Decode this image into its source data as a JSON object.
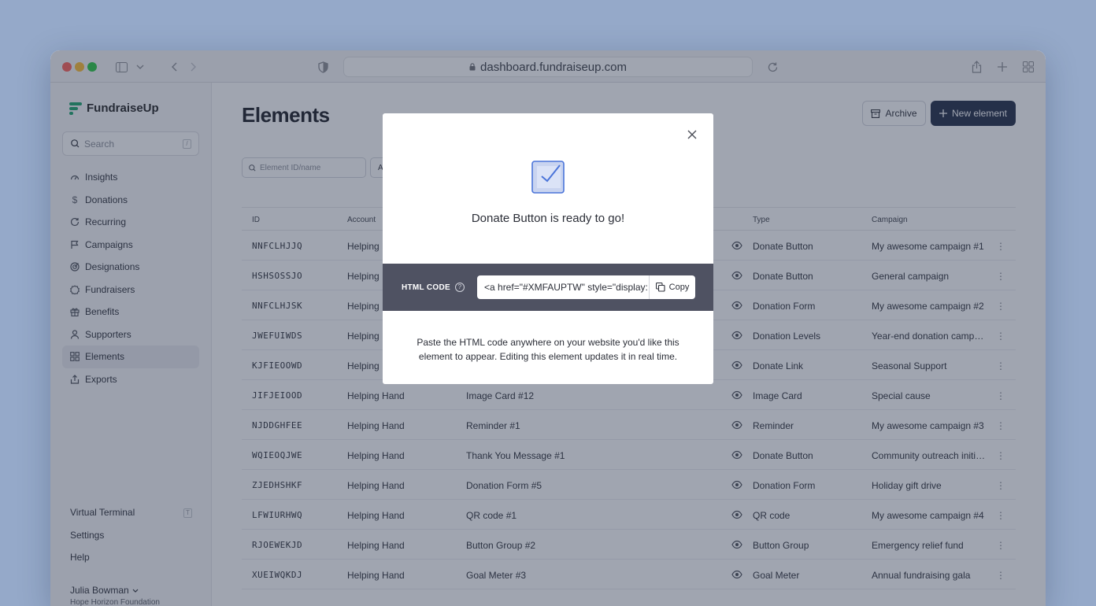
{
  "browser": {
    "url": "dashboard.fundraiseup.com"
  },
  "sidebar": {
    "logo": "FundraiseUp",
    "search_placeholder": "Search",
    "search_shortcut": "/",
    "items": [
      {
        "label": "Insights",
        "icon": "gauge-icon"
      },
      {
        "label": "Donations",
        "icon": "dollar-icon"
      },
      {
        "label": "Recurring",
        "icon": "refresh-icon"
      },
      {
        "label": "Campaigns",
        "icon": "flag-icon"
      },
      {
        "label": "Designations",
        "icon": "target-icon"
      },
      {
        "label": "Fundraisers",
        "icon": "badge-icon"
      },
      {
        "label": "Benefits",
        "icon": "gift-icon"
      },
      {
        "label": "Supporters",
        "icon": "person-icon"
      },
      {
        "label": "Elements",
        "icon": "grid-icon"
      },
      {
        "label": "Exports",
        "icon": "export-icon"
      }
    ],
    "active_item": "Elements",
    "bottom": {
      "virtual_terminal": "Virtual Terminal",
      "virtual_terminal_shortcut": "T",
      "settings": "Settings",
      "help": "Help"
    },
    "user": {
      "name": "Julia Bowman",
      "org": "Hope Horizon Foundation"
    }
  },
  "main": {
    "title": "Elements",
    "archive_label": "Archive",
    "new_element_label": "New element",
    "filter_placeholder": "Element ID/name",
    "filter2_label": "A",
    "columns": [
      "ID",
      "Account",
      "Type",
      "Campaign"
    ],
    "rows": [
      {
        "id": "NNFCLHJJQ",
        "account": "Helping H",
        "name": "",
        "type": "Donate Button",
        "campaign": "My awesome campaign #1"
      },
      {
        "id": "HSHSOSSJO",
        "account": "Helping H",
        "name": "",
        "type": "Donate Button",
        "campaign": "General campaign"
      },
      {
        "id": "NNFCLHJSK",
        "account": "Helping H",
        "name": "",
        "type": "Donation Form",
        "campaign": "My awesome campaign #2"
      },
      {
        "id": "JWEFUIWDS",
        "account": "Helping H",
        "name": "",
        "type": "Donation Levels",
        "campaign": "Year-end donation campai..."
      },
      {
        "id": "KJFIEOOWD",
        "account": "Helping H",
        "name": "",
        "type": "Donate Link",
        "campaign": "Seasonal Support"
      },
      {
        "id": "JIFJEIOOD",
        "account": "Helping Hand",
        "name": "Image Card #12",
        "type": "Image Card",
        "campaign": "Special cause"
      },
      {
        "id": "NJDDGHFEE",
        "account": "Helping Hand",
        "name": "Reminder #1",
        "type": "Reminder",
        "campaign": "My awesome campaign #3"
      },
      {
        "id": "WQIEOQJWE",
        "account": "Helping Hand",
        "name": "Thank You Message #1",
        "type": "Donate Button",
        "campaign": "Community outreach initia..."
      },
      {
        "id": "ZJEDHSHKF",
        "account": "Helping Hand",
        "name": "Donation Form #5",
        "type": "Donation Form",
        "campaign": "Holiday gift drive"
      },
      {
        "id": "LFWIURHWQ",
        "account": "Helping Hand",
        "name": "QR code #1",
        "type": "QR code",
        "campaign": "My awesome campaign #4"
      },
      {
        "id": "RJOEWEKJD",
        "account": "Helping Hand",
        "name": "Button Group #2",
        "type": "Button Group",
        "campaign": "Emergency relief fund"
      },
      {
        "id": "XUEIWQKDJ",
        "account": "Helping Hand",
        "name": "Goal Meter #3",
        "type": "Goal Meter",
        "campaign": "Annual fundraising gala"
      }
    ]
  },
  "modal": {
    "heading": "Donate Button is ready to go!",
    "code_label": "HTML CODE",
    "code_value": "<a href=\"#XMFAUPTW\" style=\"display:",
    "copy_label": "Copy",
    "description": "Paste the HTML code anywhere on your website you'd like this element to appear. Editing this element updates it in real time."
  },
  "colors": {
    "primary_button": "#1f2a44",
    "brand_green": "#1aa56b",
    "code_band": "#4f5262",
    "overlay": "rgba(45,55,80,0.45)"
  }
}
